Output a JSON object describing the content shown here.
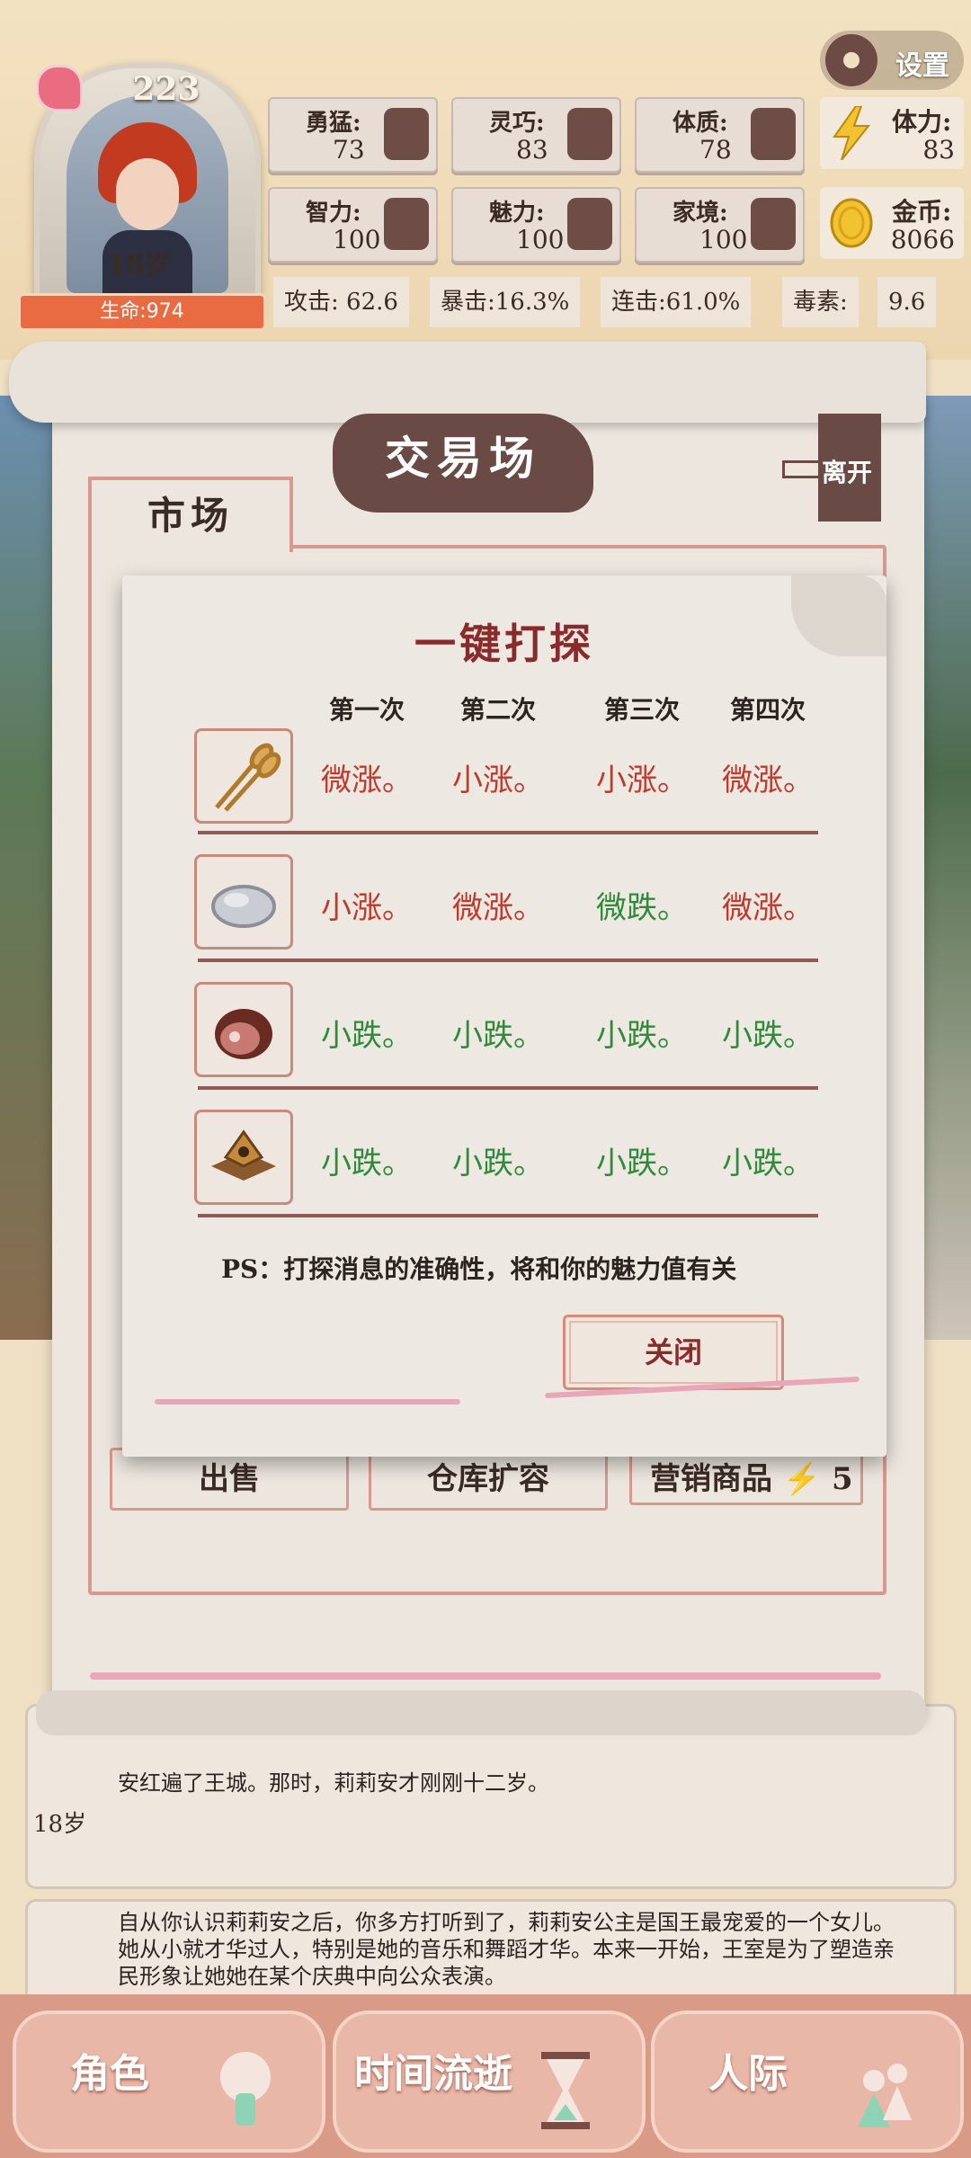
{
  "player": {
    "score": "223",
    "age": "18岁",
    "life": "生命:974"
  },
  "settings": {
    "label": "设置"
  },
  "attributes": [
    {
      "label": "勇猛:",
      "value": "73",
      "icon": "fist-icon"
    },
    {
      "label": "灵巧:",
      "value": "83",
      "icon": "cloak-icon"
    },
    {
      "label": "体质:",
      "value": "78",
      "icon": "muscle-arm-icon"
    },
    {
      "label": "智力:",
      "value": "100",
      "icon": "brain-head-icon"
    },
    {
      "label": "魅力:",
      "value": "100",
      "icon": "flower-icon"
    },
    {
      "label": "家境:",
      "value": "100",
      "icon": "coin-hand-icon"
    }
  ],
  "resources": {
    "stamina": {
      "label": "体力:",
      "value": "83",
      "icon": "lightning-icon"
    },
    "gold": {
      "label": "金币:",
      "value": "8066",
      "icon": "gold-coin-icon"
    }
  },
  "combat": {
    "attack": "攻击: 62.6",
    "crit": "暴击:16.3%",
    "combo": "连击:61.0%",
    "poison_label": "毒素:",
    "poison_value": "9.6"
  },
  "market": {
    "title": "交易场",
    "exit": "离开",
    "tab": "市场",
    "actions": {
      "sell": "出售",
      "expand": "仓库扩容",
      "promote": "营销商品",
      "promote_cost": "5"
    }
  },
  "popup": {
    "title": "一键打探",
    "columns": [
      "第一次",
      "第二次",
      "第三次",
      "第四次"
    ],
    "rows": [
      {
        "item": "wheat-icon",
        "forecasts": [
          {
            "text": "微涨。",
            "trend": "up"
          },
          {
            "text": "小涨。",
            "trend": "up"
          },
          {
            "text": "小涨。",
            "trend": "up"
          },
          {
            "text": "微涨。",
            "trend": "up"
          }
        ]
      },
      {
        "item": "stone-icon",
        "forecasts": [
          {
            "text": "小涨。",
            "trend": "up"
          },
          {
            "text": "微涨。",
            "trend": "up"
          },
          {
            "text": "微跌。",
            "trend": "down"
          },
          {
            "text": "微涨。",
            "trend": "up"
          }
        ]
      },
      {
        "item": "meat-icon",
        "forecasts": [
          {
            "text": "小跌。",
            "trend": "down"
          },
          {
            "text": "小跌。",
            "trend": "down"
          },
          {
            "text": "小跌。",
            "trend": "down"
          },
          {
            "text": "小跌。",
            "trend": "down"
          }
        ]
      },
      {
        "item": "ore-crate-icon",
        "forecasts": [
          {
            "text": "小跌。",
            "trend": "down"
          },
          {
            "text": "小跌。",
            "trend": "down"
          },
          {
            "text": "小跌。",
            "trend": "down"
          },
          {
            "text": "小跌。",
            "trend": "down"
          }
        ]
      }
    ],
    "note": "PS：打探消息的准确性，将和你的魅力值有关",
    "close": "关闭",
    "colors": {
      "up": "#c0392b",
      "down": "#2e8b3a"
    }
  },
  "log": [
    {
      "age": "18岁",
      "text": "安红遍了王城。那时，莉莉安才刚刚十二岁。"
    },
    {
      "age": "18岁",
      "text": "自从你认识莉莉安之后，你多方打听到了，莉莉安公主是国王最宠爱的一个女儿。她从小就才华过人，特别是她的音乐和舞蹈才华。本来一开始，王室是为了塑造亲民形象让她她在某个庆典中向公众表演。"
    }
  ],
  "nav": {
    "character": "角色",
    "time": "时间流逝",
    "social": "人际"
  }
}
